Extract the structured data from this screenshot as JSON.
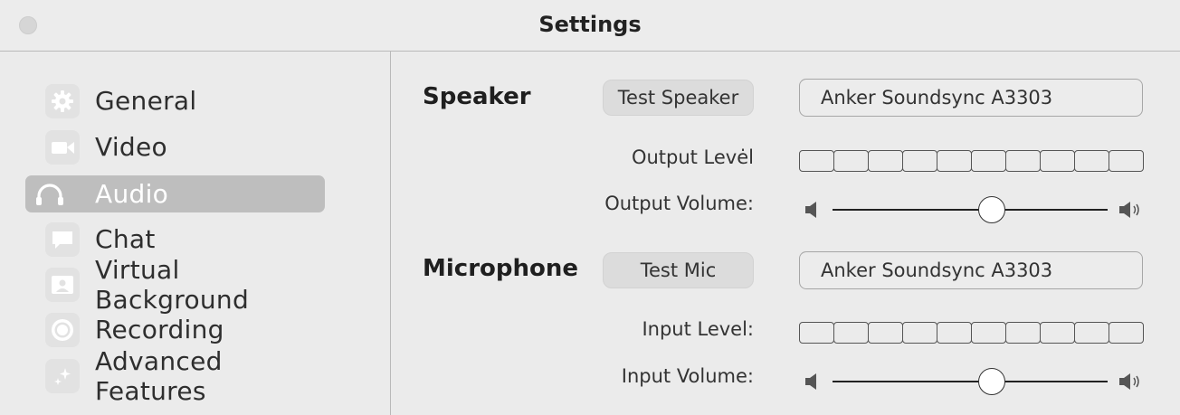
{
  "window": {
    "title": "Settings"
  },
  "sidebar": {
    "items": [
      {
        "label": "General",
        "icon": "gear-icon",
        "active": false
      },
      {
        "label": "Video",
        "icon": "video-camera-icon",
        "active": false
      },
      {
        "label": "Audio",
        "icon": "headphones-icon",
        "active": true
      },
      {
        "label": "Chat",
        "icon": "chat-bubble-icon",
        "active": false
      },
      {
        "label": "Virtual Background",
        "icon": "virtual-background-icon",
        "active": false
      },
      {
        "label": "Recording",
        "icon": "record-icon",
        "active": false
      },
      {
        "label": "Advanced Features",
        "icon": "sparkle-icon",
        "active": false
      }
    ]
  },
  "speaker": {
    "title": "Speaker",
    "test_label": "Test Speaker",
    "device": "Anker Soundsync A3303",
    "level_label": "Output Levėl",
    "volume_label": "Output Volume:",
    "volume_fraction": 0.58,
    "level_segments": 10
  },
  "microphone": {
    "title": "Microphone",
    "test_label": "Test Mic",
    "device": "Anker Soundsync A3303",
    "level_label": "Input Level:",
    "volume_label": "Input Volume:",
    "volume_fraction": 0.58,
    "level_segments": 10
  },
  "colors": {
    "window_bg": "#ebebeb",
    "active_nav": "#bebebe",
    "button_bg": "#dcdcdc"
  }
}
